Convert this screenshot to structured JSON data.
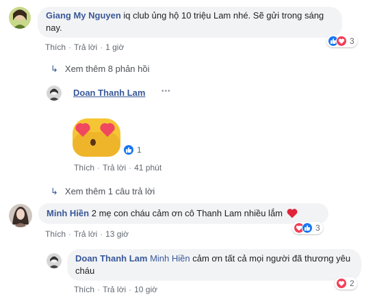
{
  "ui": {
    "like": "Thích",
    "reply": "Trả lời",
    "sep": "·"
  },
  "colors": {
    "author": "#385898",
    "bubble": "#f2f3f5",
    "meta": "#606770",
    "like_blue": "#1877f2",
    "love_red": "#f33e58"
  },
  "comments": [
    {
      "author": "Giang My Nguyen",
      "text": "iq club ủng hộ 10 triệu Lam nhé. Sẽ gửi trong sáng nay.",
      "time": "1 giờ",
      "reactions": [
        "like-icon",
        "love-icon"
      ],
      "reaction_count": "3"
    }
  ],
  "more_replies_1": "Xem thêm 8 phản hồi",
  "reply_1": {
    "author": "Doan Thanh Lam",
    "options": "•••",
    "sticker": "heart-eyes-emoji",
    "reaction_count": "1",
    "time": "41 phút"
  },
  "more_replies_2": "Xem thêm 1 câu trả lời",
  "comment_2": {
    "author": "Minh Hiền",
    "text": "2 mẹ con cháu cảm ơn cô Thanh Lam nhiều lắm",
    "emoji": "red-heart",
    "reaction_count": "3",
    "time": "13 giờ"
  },
  "reply_2": {
    "author": "Doan Thanh Lam",
    "mention": "Minh Hiền",
    "text": "cảm ơn tất cả mọi người đã thương yêu cháu",
    "reaction_count": "2",
    "time": "10 giờ"
  }
}
